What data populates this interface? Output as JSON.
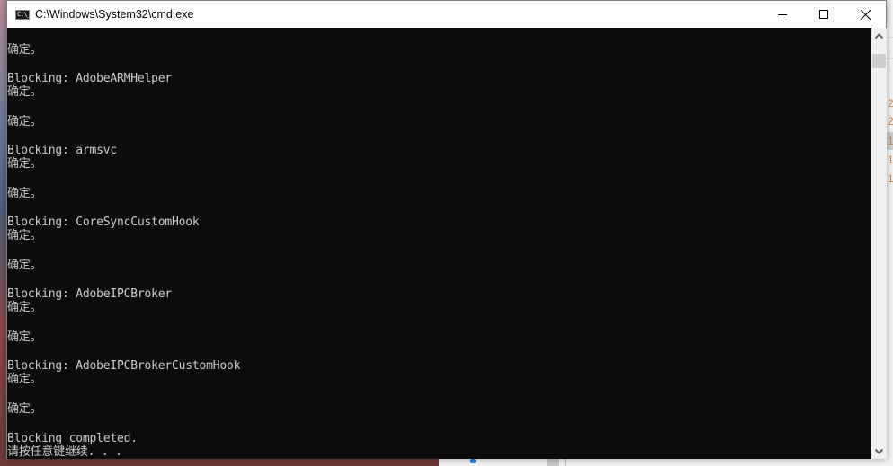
{
  "window": {
    "title": "C:\\Windows\\System32\\cmd.exe",
    "icon_label": "C:\\_",
    "controls": {
      "minimize": "minimize",
      "maximize": "maximize",
      "close": "close"
    }
  },
  "console": {
    "lines": [
      "",
      "确定。",
      "",
      "Blocking: AdobeARMHelper",
      "确定。",
      "",
      "确定。",
      "",
      "Blocking: armsvc",
      "确定。",
      "",
      "确定。",
      "",
      "Blocking: CoreSyncCustomHook",
      "确定。",
      "",
      "确定。",
      "",
      "Blocking: AdobeIPCBroker",
      "确定。",
      "",
      "确定。",
      "",
      "Blocking: AdobeIPCBrokerCustomHook",
      "确定。",
      "",
      "确定。",
      "",
      "Blocking completed.",
      "请按任意键继续. . ."
    ]
  },
  "background": {
    "right_numbers": [
      "2",
      "2",
      "1",
      "1",
      "1"
    ]
  }
}
